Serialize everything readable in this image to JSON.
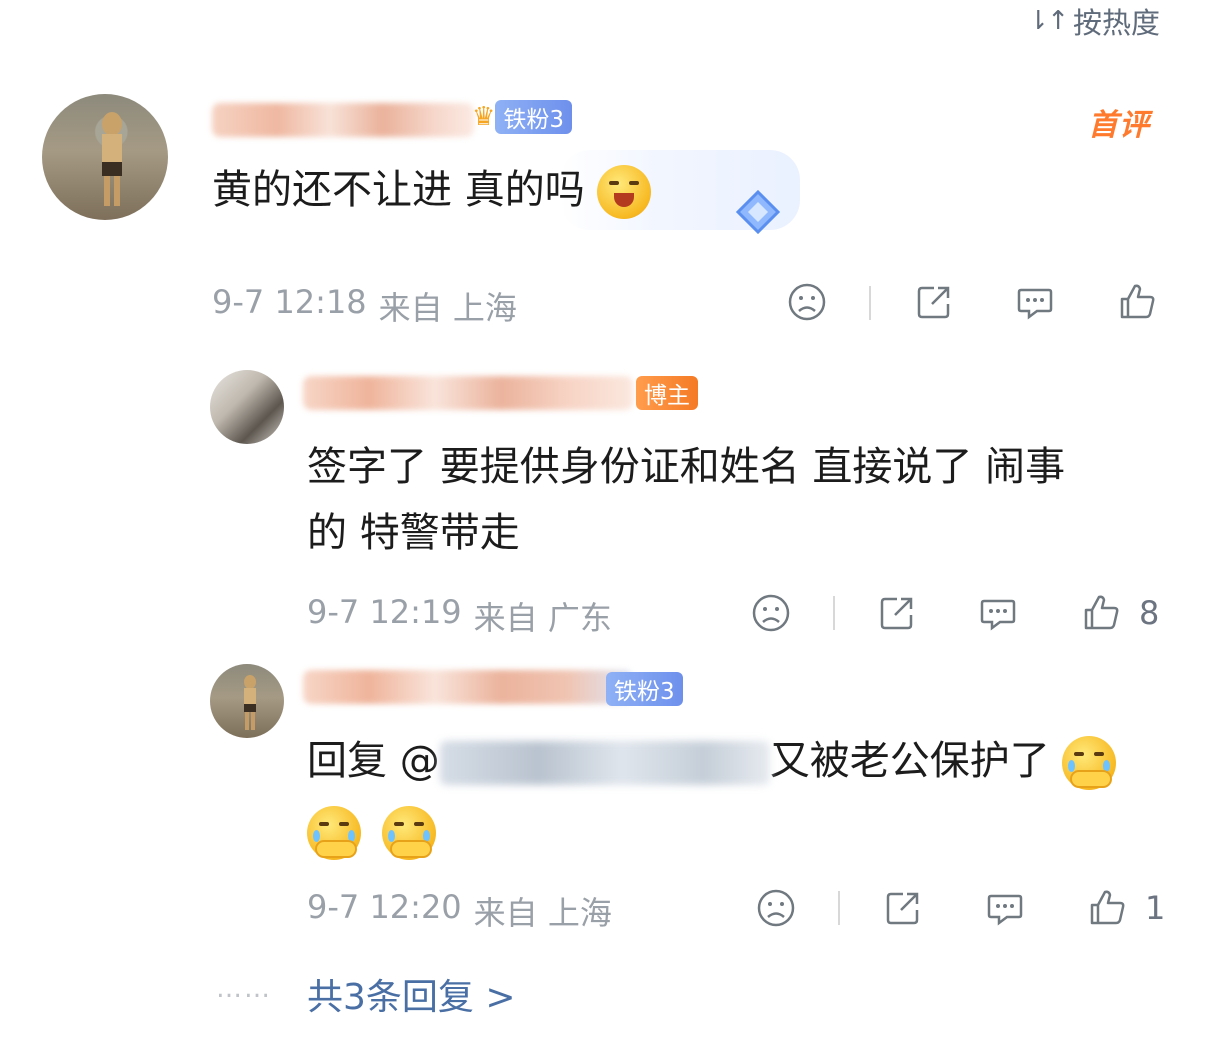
{
  "header": {
    "sort_label": "按热度",
    "sort_icon": "sort-icon"
  },
  "comments": [
    {
      "badge": "铁粉3",
      "tag": "首评",
      "text": "黄的还不让进 真的吗",
      "time": "9-7 12:18",
      "location": "来自 上海",
      "like_count": ""
    },
    {
      "badge": "博主",
      "text_line1": "签字了 要提供身份证和姓名 直接说了 闹事",
      "text_line2": "的 特警带走",
      "time": "9-7 12:19",
      "location": "来自 广东",
      "like_count": "8"
    },
    {
      "badge": "铁粉3",
      "reply_prefix": "回复 @",
      "text": "又被老公保护了",
      "time": "9-7 12:20",
      "location": "来自 上海",
      "like_count": "1"
    }
  ],
  "more_replies": {
    "dots": "……",
    "label": "共3条回复 >"
  },
  "colors": {
    "accent_orange": "#ff7a2c",
    "link_blue": "#4a6fa5",
    "meta_gray": "#9aa0a8",
    "fan_badge": "#7b9cf0",
    "host_badge": "#f57a25"
  },
  "icons": [
    "sad-face-icon",
    "share-icon",
    "comment-icon",
    "like-icon"
  ]
}
